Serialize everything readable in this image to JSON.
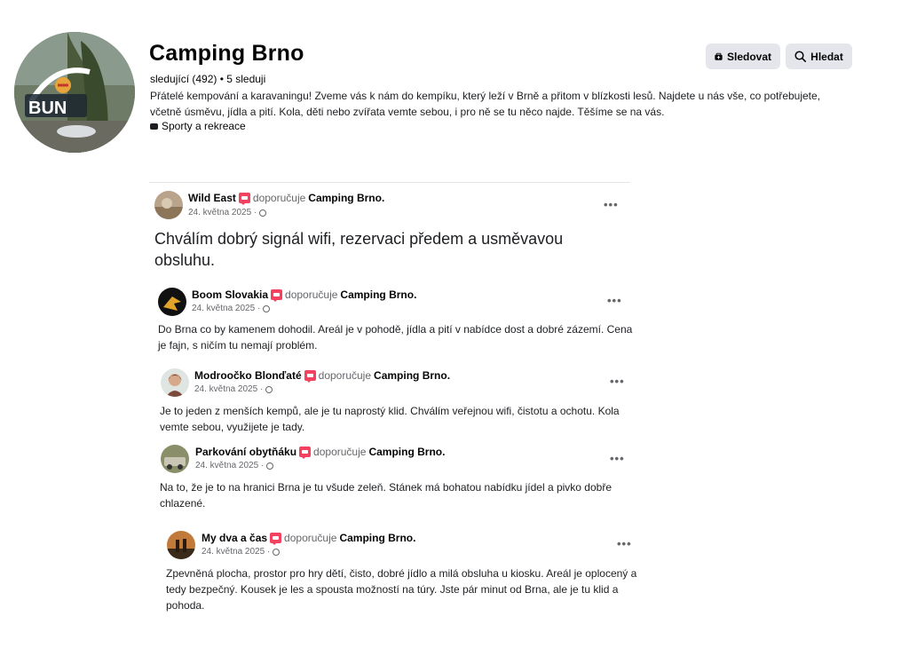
{
  "header": {
    "title": "Camping Brno",
    "stats": "sledující (492) • 5 sleduji",
    "description": "Přátelé kempování a karavaningu! Zveme vás k nám do kempíku, který leží v Brně a přitom v blízkosti lesů. Najdete u nás vše, co potřebujete, včetně úsměvu, jídla a pití. Kola, děti nebo zvířata vemte sebou, i pro ně se tu něco najde. Těšíme se na vás.",
    "category": "Sporty a rekreace",
    "avatar_text": "BUN",
    "follow_label": "Sledovat",
    "search_label": "Hledat"
  },
  "icons": {
    "follow": "follow-icon",
    "search": "search-icon",
    "category": "category-icon",
    "recommend": "recommend-icon",
    "globe": "globe-icon",
    "more": "more-icon"
  },
  "colors": {
    "recommend_badge": "#f3425f",
    "button_bg": "#e4e6eb",
    "secondary_text": "#65676b"
  },
  "posts": [
    {
      "author": "Wild East",
      "recommends": "doporučuje",
      "page": "Camping Brno.",
      "date": "24. května 2025 ·",
      "text": "Chválím dobrý signál wifi, rezervaci předem a usměvavou obsluhu.",
      "more": "•••"
    },
    {
      "author": "Boom Slovakia",
      "recommends": "doporučuje",
      "page": "Camping Brno.",
      "date": "24. května 2025 ·",
      "text": "Do Brna co by kamenem dohodil. Areál je v pohodě, jídla a pití v nabídce dost a dobré zázemí. Cena je fajn, s ničím tu nemají problém.",
      "more": "•••"
    },
    {
      "author": "Modroočko Blonďaté",
      "recommends": "doporučuje",
      "page": "Camping Brno.",
      "date": "24. května 2025 ·",
      "text": "Je to jeden z menších kempů, ale je tu naprostý klid. Chválím veřejnou wifi, čistotu a ochotu. Kola vemte sebou, využijete je tady.",
      "more": "•••"
    },
    {
      "author": "Parkování obytňáku",
      "recommends": "doporučuje",
      "page": "Camping Brno.",
      "date": "24. května 2025 ·",
      "text": "Na to, že je to na hranici Brna je tu všude zeleň. Stánek má bohatou nabídku jídel a pivko dobře chlazené.",
      "more": "•••"
    },
    {
      "author": "My dva a čas",
      "recommends": "doporučuje",
      "page": "Camping Brno.",
      "date": "24. května 2025 ·",
      "text": "Zpevněná plocha, prostor pro hry dětí, čisto, dobré jídlo a milá obsluha u kiosku. Areál je oplocený a tedy bezpečný. Kousek je les a spousta možností na túry. Jste pár minut od Brna, ale je tu klid a pohoda.",
      "more": "•••"
    }
  ]
}
